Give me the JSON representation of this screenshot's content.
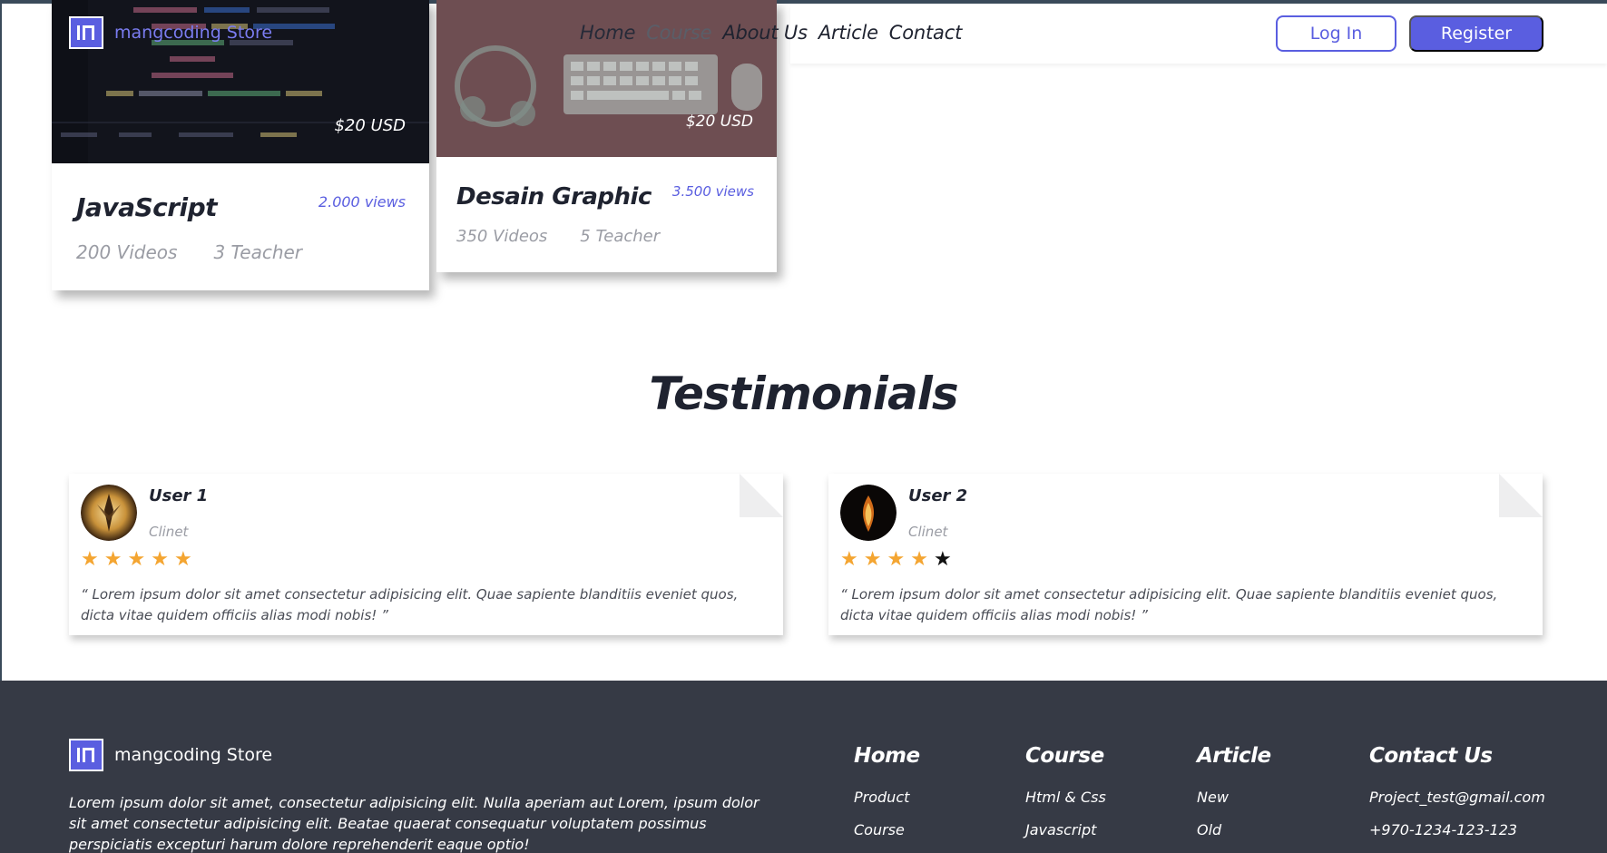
{
  "header": {
    "brand": "mangcoding Store",
    "nav": [
      "Home",
      "Course",
      "About Us",
      "Article",
      "Contact"
    ],
    "login_label": "Log In",
    "register_label": "Register"
  },
  "courses": [
    {
      "title": "JavaScript",
      "price": "$20 USD",
      "views": "2.000 views",
      "videos": "200 Videos",
      "teachers": "3 Teacher"
    },
    {
      "title": "Desain Graphic",
      "price": "$20 USD",
      "views": "3.500 views",
      "videos": "350 Videos",
      "teachers": "5 Teacher"
    }
  ],
  "testimonials": {
    "title": "Testimonials",
    "items": [
      {
        "name": "User 1",
        "role": "Clinet",
        "rating": 5,
        "quote": "“ Lorem ipsum dolor sit amet consectetur adipisicing elit. Quae sapiente blanditiis eveniet quos, dicta vitae quidem officiis alias modi nobis! ”"
      },
      {
        "name": "User 2",
        "role": "Clinet",
        "rating": 4,
        "quote": "“ Lorem ipsum dolor sit amet consectetur adipisicing elit. Quae sapiente blanditiis eveniet quos, dicta vitae quidem officiis alias modi nobis! ”"
      }
    ]
  },
  "footer": {
    "brand": "mangcoding Store",
    "description": "Lorem ipsum dolor sit amet, consectetur adipisicing elit. Nulla aperiam aut Lorem, ipsum dolor sit amet consectetur adipisicing elit. Beatae quaerat consequatur voluptatem possimus perspiciatis excepturi harum dolore reprehenderit eaque optio!",
    "columns": [
      {
        "title": "Home",
        "links": [
          "Product",
          "Course"
        ]
      },
      {
        "title": "Course",
        "links": [
          "Html & Css",
          "Javascript"
        ]
      },
      {
        "title": "Article",
        "links": [
          "New",
          "Old"
        ]
      },
      {
        "title": "Contact Us",
        "links": [
          "Project_test@gmail.com",
          "+970-1234-123-123"
        ]
      }
    ]
  },
  "colors": {
    "accent": "#5a5ee0",
    "star": "#f4a531",
    "footer_bg": "#363a45",
    "text_dark": "#1f2330"
  }
}
